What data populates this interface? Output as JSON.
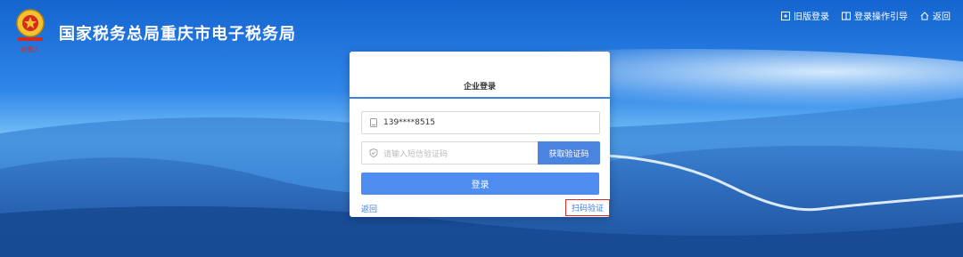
{
  "header": {
    "site_title": "国家税务总局重庆市电子税务局",
    "nav": [
      {
        "label": "旧版登录",
        "icon": "old-login-icon"
      },
      {
        "label": "登录操作引导",
        "icon": "guide-book-icon"
      },
      {
        "label": "返回",
        "icon": "home-icon"
      }
    ]
  },
  "login": {
    "title": "企业登录",
    "phone_value": "139****8515",
    "sms_placeholder": "请输入短信验证码",
    "get_code_label": "获取验证码",
    "submit_label": "登录",
    "back_label": "返回",
    "scan_label": "扫码验证"
  },
  "colors": {
    "primary": "#4f8ef0",
    "highlight_box": "#d82a2a"
  }
}
